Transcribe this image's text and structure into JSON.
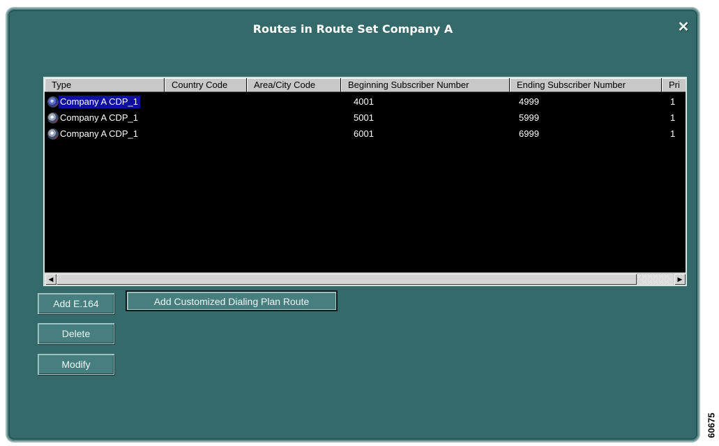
{
  "window": {
    "title": "Routes in Route Set Company A",
    "close_glyph": "⯐"
  },
  "table": {
    "columns": [
      "Type",
      "Country Code",
      "Area/City Code",
      "Beginning Subscriber Number",
      "Ending Subscriber Number",
      "Pri"
    ],
    "rows": [
      {
        "type": "Company A CDP_1",
        "country": "",
        "area": "",
        "begin": "4001",
        "end": "4999",
        "pri": "1",
        "selected": true
      },
      {
        "type": "Company A CDP_1",
        "country": "",
        "area": "",
        "begin": "5001",
        "end": "5999",
        "pri": "1",
        "selected": false
      },
      {
        "type": "Company A CDP_1",
        "country": "",
        "area": "",
        "begin": "6001",
        "end": "6999",
        "pri": "1",
        "selected": false
      }
    ],
    "row_icon": "route-globe-icon"
  },
  "buttons": {
    "add_e164": "Add E.164",
    "add_customized": "Add Customized Dialing Plan Route",
    "delete": "Delete",
    "modify": "Modify"
  },
  "figure_id": "60675",
  "colors": {
    "window_bg": "#356a6a",
    "grid_bg": "#000000",
    "selection": "#1010a0"
  }
}
